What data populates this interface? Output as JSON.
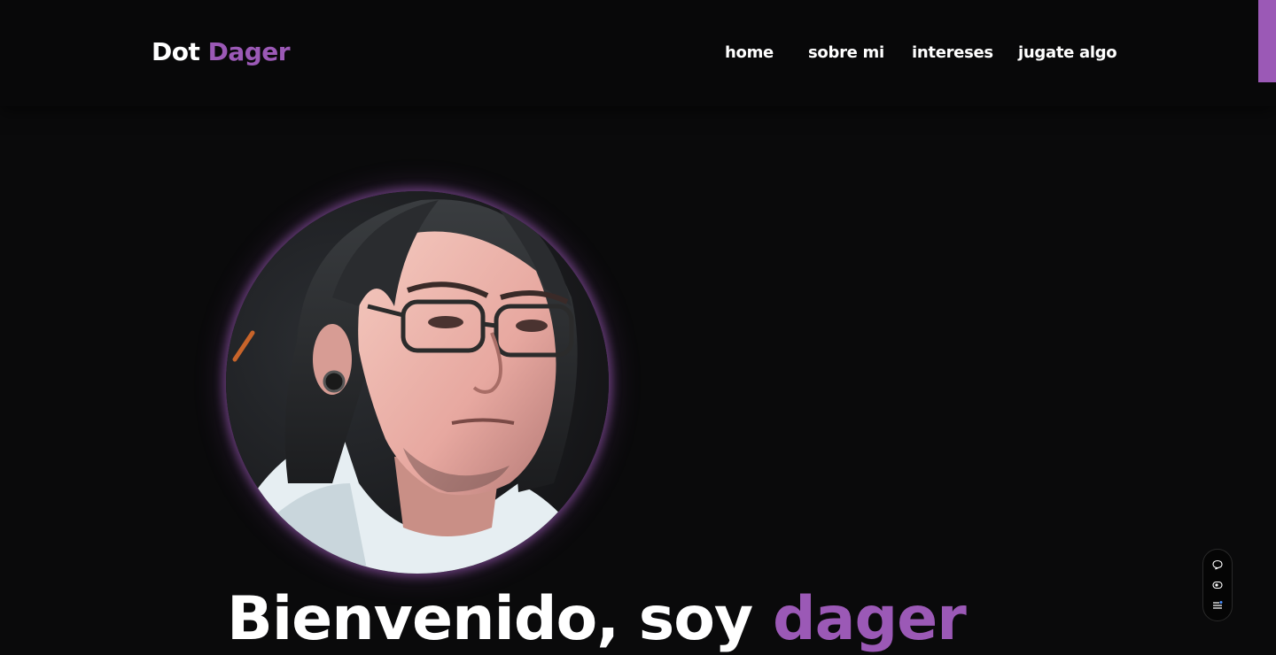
{
  "brand": {
    "first": "Dot",
    "second": "Dager",
    "accent_color": "#9b59b6"
  },
  "nav": {
    "items": [
      {
        "label": "home"
      },
      {
        "label": "sobre mi"
      },
      {
        "label": "intereses"
      },
      {
        "label": "jugate algo"
      }
    ]
  },
  "hero": {
    "title_prefix": "Bienvenido, soy",
    "title_accent": "dager",
    "avatar_alt": "illustrated portrait"
  },
  "widget": {
    "icons": [
      "chat-bubble-icon",
      "eye-icon",
      "menu-icon"
    ]
  }
}
